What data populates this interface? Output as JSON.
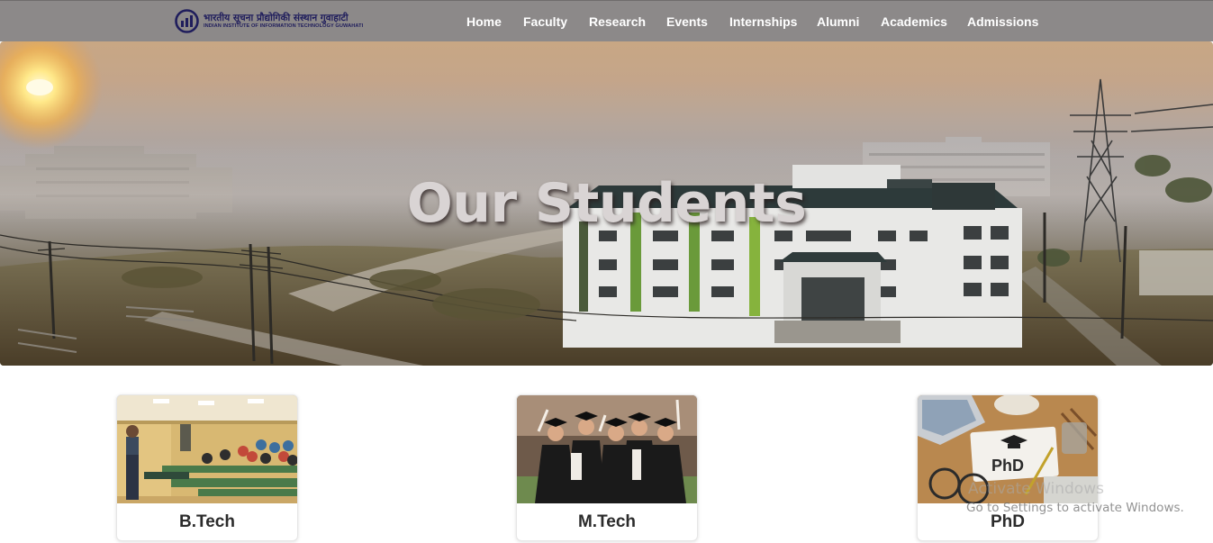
{
  "header": {
    "logo": {
      "hindi": "भारतीय सूचना प्रौद्योगिकी संस्थान गुवाहाटी",
      "english": "INDIAN INSTITUTE OF INFORMATION TECHNOLOGY GUWAHATI",
      "icon": "iiitg-logo-icon"
    },
    "nav": [
      {
        "label": "Home"
      },
      {
        "label": "Faculty"
      },
      {
        "label": "Research"
      },
      {
        "label": "Events"
      },
      {
        "label": "Internships"
      },
      {
        "label": "Alumni"
      },
      {
        "label": "Academics"
      },
      {
        "label": "Admissions"
      }
    ],
    "colors": {
      "bar": "#8c8989",
      "logo": "#1f1d5c"
    }
  },
  "hero": {
    "title": "Our Students",
    "image": "campus-building-foggy-sunrise"
  },
  "programs": [
    {
      "title": "B.Tech",
      "image": "classroom-lecture-photo"
    },
    {
      "title": "M.Tech",
      "image": "graduates-celebrating-photo"
    },
    {
      "title": "PhD",
      "image": "phd-desk-photo"
    }
  ],
  "watermark": {
    "title": "Activate Windows",
    "subtitle": "Go to Settings to activate Windows."
  }
}
